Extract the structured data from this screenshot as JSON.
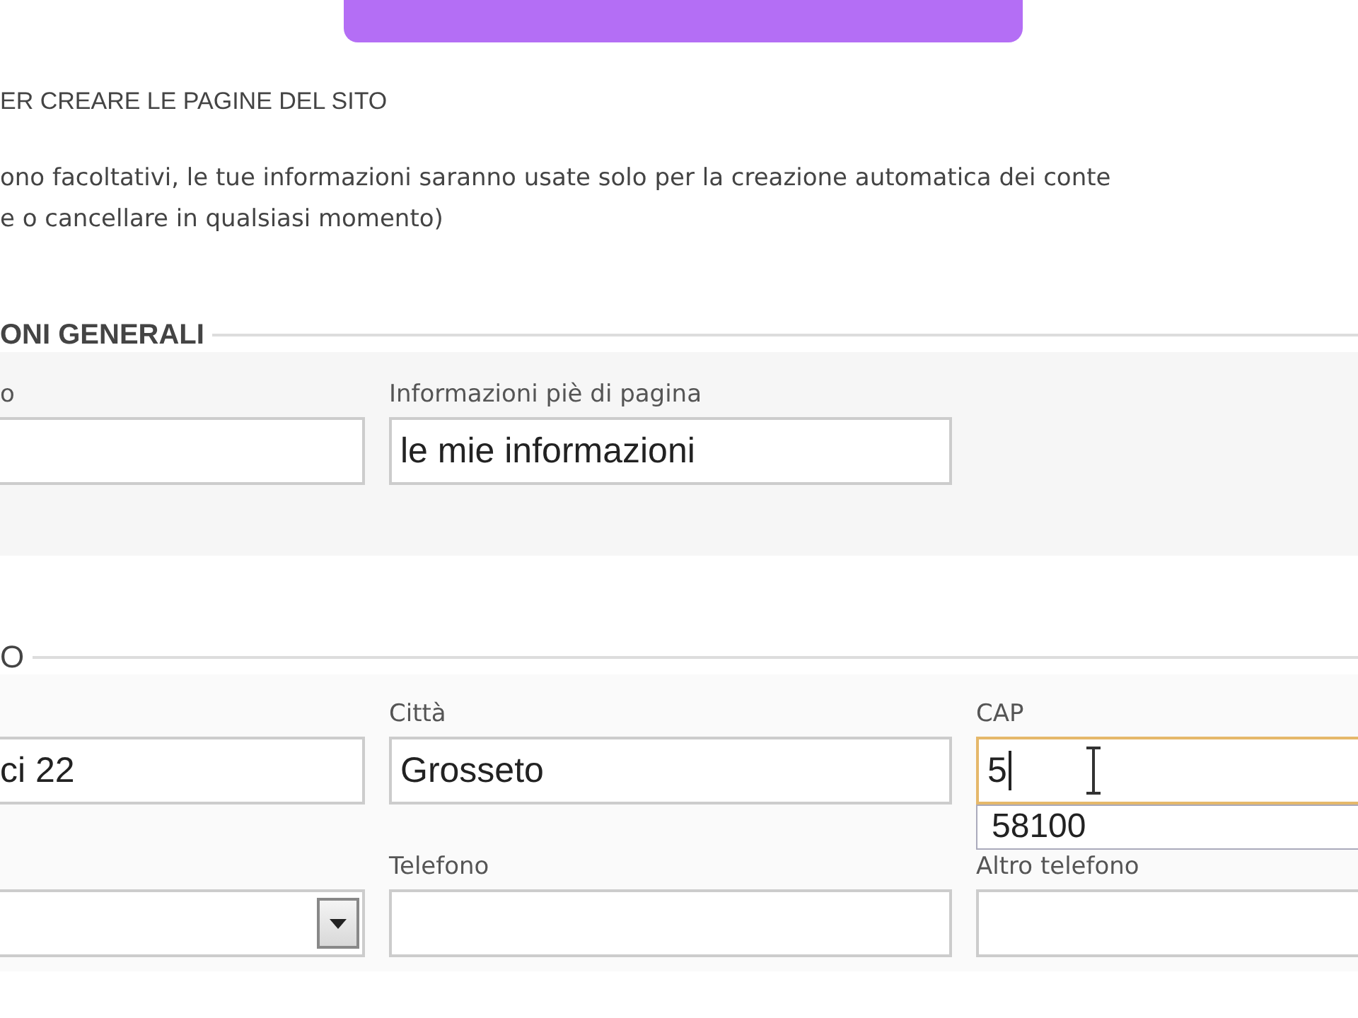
{
  "heading": "ER CREARE LE PAGINE DEL SITO",
  "intro": [
    "ono facoltativi, le tue informazioni saranno usate solo per la creazione automatica dei conte",
    "e o cancellare in qualsiasi momento)"
  ],
  "sections": [
    {
      "legend": "ONI GENERALI",
      "rows": [
        [
          {
            "kind": "text",
            "label": "o",
            "focused": false
          },
          {
            "kind": "text",
            "label": "Informazioni piè di pagina",
            "value": "le mie informazioni",
            "focused": false
          }
        ]
      ]
    },
    {
      "legend": "O",
      "rows": [
        [
          {
            "kind": "text",
            "value": "ci 22",
            "focused": false
          },
          {
            "kind": "text",
            "label": "Città",
            "value": "Grosseto",
            "focused": false
          },
          {
            "kind": "text",
            "label": "CAP",
            "value": "5",
            "focused": true,
            "suggestions": [
              "58100"
            ]
          }
        ],
        [
          {
            "kind": "select",
            "focused": false
          },
          {
            "kind": "text",
            "label": "Telefono",
            "focused": false
          },
          {
            "kind": "text",
            "label": "Altro telefono",
            "focused": false
          }
        ]
      ]
    }
  ]
}
